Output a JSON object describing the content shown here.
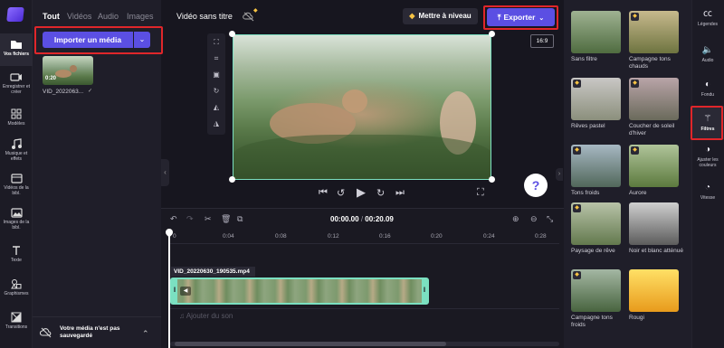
{
  "left_rail": {
    "items": [
      {
        "label": "Vos fichiers",
        "icon": "folder-icon"
      },
      {
        "label": "Enregistrer et créer",
        "icon": "camera-icon"
      },
      {
        "label": "Modèles",
        "icon": "templates-icon"
      },
      {
        "label": "Musique et effets",
        "icon": "music-icon"
      },
      {
        "label": "Vidéos de la bibl.",
        "icon": "video-library-icon"
      },
      {
        "label": "Images de la bibl.",
        "icon": "image-library-icon"
      },
      {
        "label": "Texte",
        "icon": "text-icon"
      },
      {
        "label": "Graphismes",
        "icon": "graphics-icon"
      },
      {
        "label": "Transitions",
        "icon": "transitions-icon"
      }
    ]
  },
  "media_panel": {
    "tabs": [
      "Tout",
      "Vidéos",
      "Audio",
      "Images"
    ],
    "import_label": "Importer un média",
    "clip_duration": "0:20",
    "clip_name": "VID_2022063...",
    "save_status": "Votre média n'est pas sauvegardé"
  },
  "header": {
    "project_title": "Vidéo sans titre",
    "upgrade_label": "Mettre à niveau",
    "export_label": "Exporter",
    "aspect_ratio": "16:9"
  },
  "timeline": {
    "current_time": "00:00.00",
    "separator": " / ",
    "total_time": "00:20.09",
    "ticks": [
      "0",
      "0:04",
      "0:08",
      "0:12",
      "0:16",
      "0:20",
      "0:24",
      "0:28"
    ],
    "clip_label": "VID_20220630_190535.mp4",
    "audio_hint": "Ajouter du son"
  },
  "filters": {
    "items": [
      {
        "name": "Sans filtre",
        "premium": false,
        "color_a": "#9fb292",
        "color_b": "#4f6c40"
      },
      {
        "name": "Campagne tons chauds",
        "premium": true,
        "color_a": "#c7b98d",
        "color_b": "#6e7440"
      },
      {
        "name": "Rêves pastel",
        "premium": true,
        "color_a": "#c9c7c5",
        "color_b": "#8b8f7c"
      },
      {
        "name": "Coucher de soleil d'hiver",
        "premium": true,
        "color_a": "#b9a4a8",
        "color_b": "#6a6a5b"
      },
      {
        "name": "Tons froids",
        "premium": true,
        "color_a": "#a7b8c3",
        "color_b": "#51675a"
      },
      {
        "name": "Aurore",
        "premium": true,
        "color_a": "#b0c49a",
        "color_b": "#5c7a3e"
      },
      {
        "name": "Paysage de rêve",
        "premium": true,
        "color_a": "#b8c3a8",
        "color_b": "#63794e"
      },
      {
        "name": "Noir et blanc atténué",
        "premium": false,
        "color_a": "#cfcfcf",
        "color_b": "#5c5c5c"
      },
      {
        "name": "Campagne tons froids",
        "premium": true,
        "color_a": "#a4b7a3",
        "color_b": "#48643f"
      },
      {
        "name": "Rougi",
        "premium": false,
        "color_a": "#ffe066",
        "color_b": "#e89b1c"
      }
    ]
  },
  "right_rail": {
    "items": [
      {
        "label": "Légendes",
        "icon": "captions-icon"
      },
      {
        "label": "Audio",
        "icon": "audio-icon"
      },
      {
        "label": "Fondu",
        "icon": "fade-icon"
      },
      {
        "label": "Filtres",
        "icon": "magic-wand-icon"
      },
      {
        "label": "Ajuster les couleurs",
        "icon": "adjust-colors-icon"
      },
      {
        "label": "Vitesse",
        "icon": "speed-icon"
      }
    ]
  },
  "colors": {
    "accent": "#5b4fe3",
    "selection": "#7be0c1",
    "highlight": "#e0262a"
  }
}
